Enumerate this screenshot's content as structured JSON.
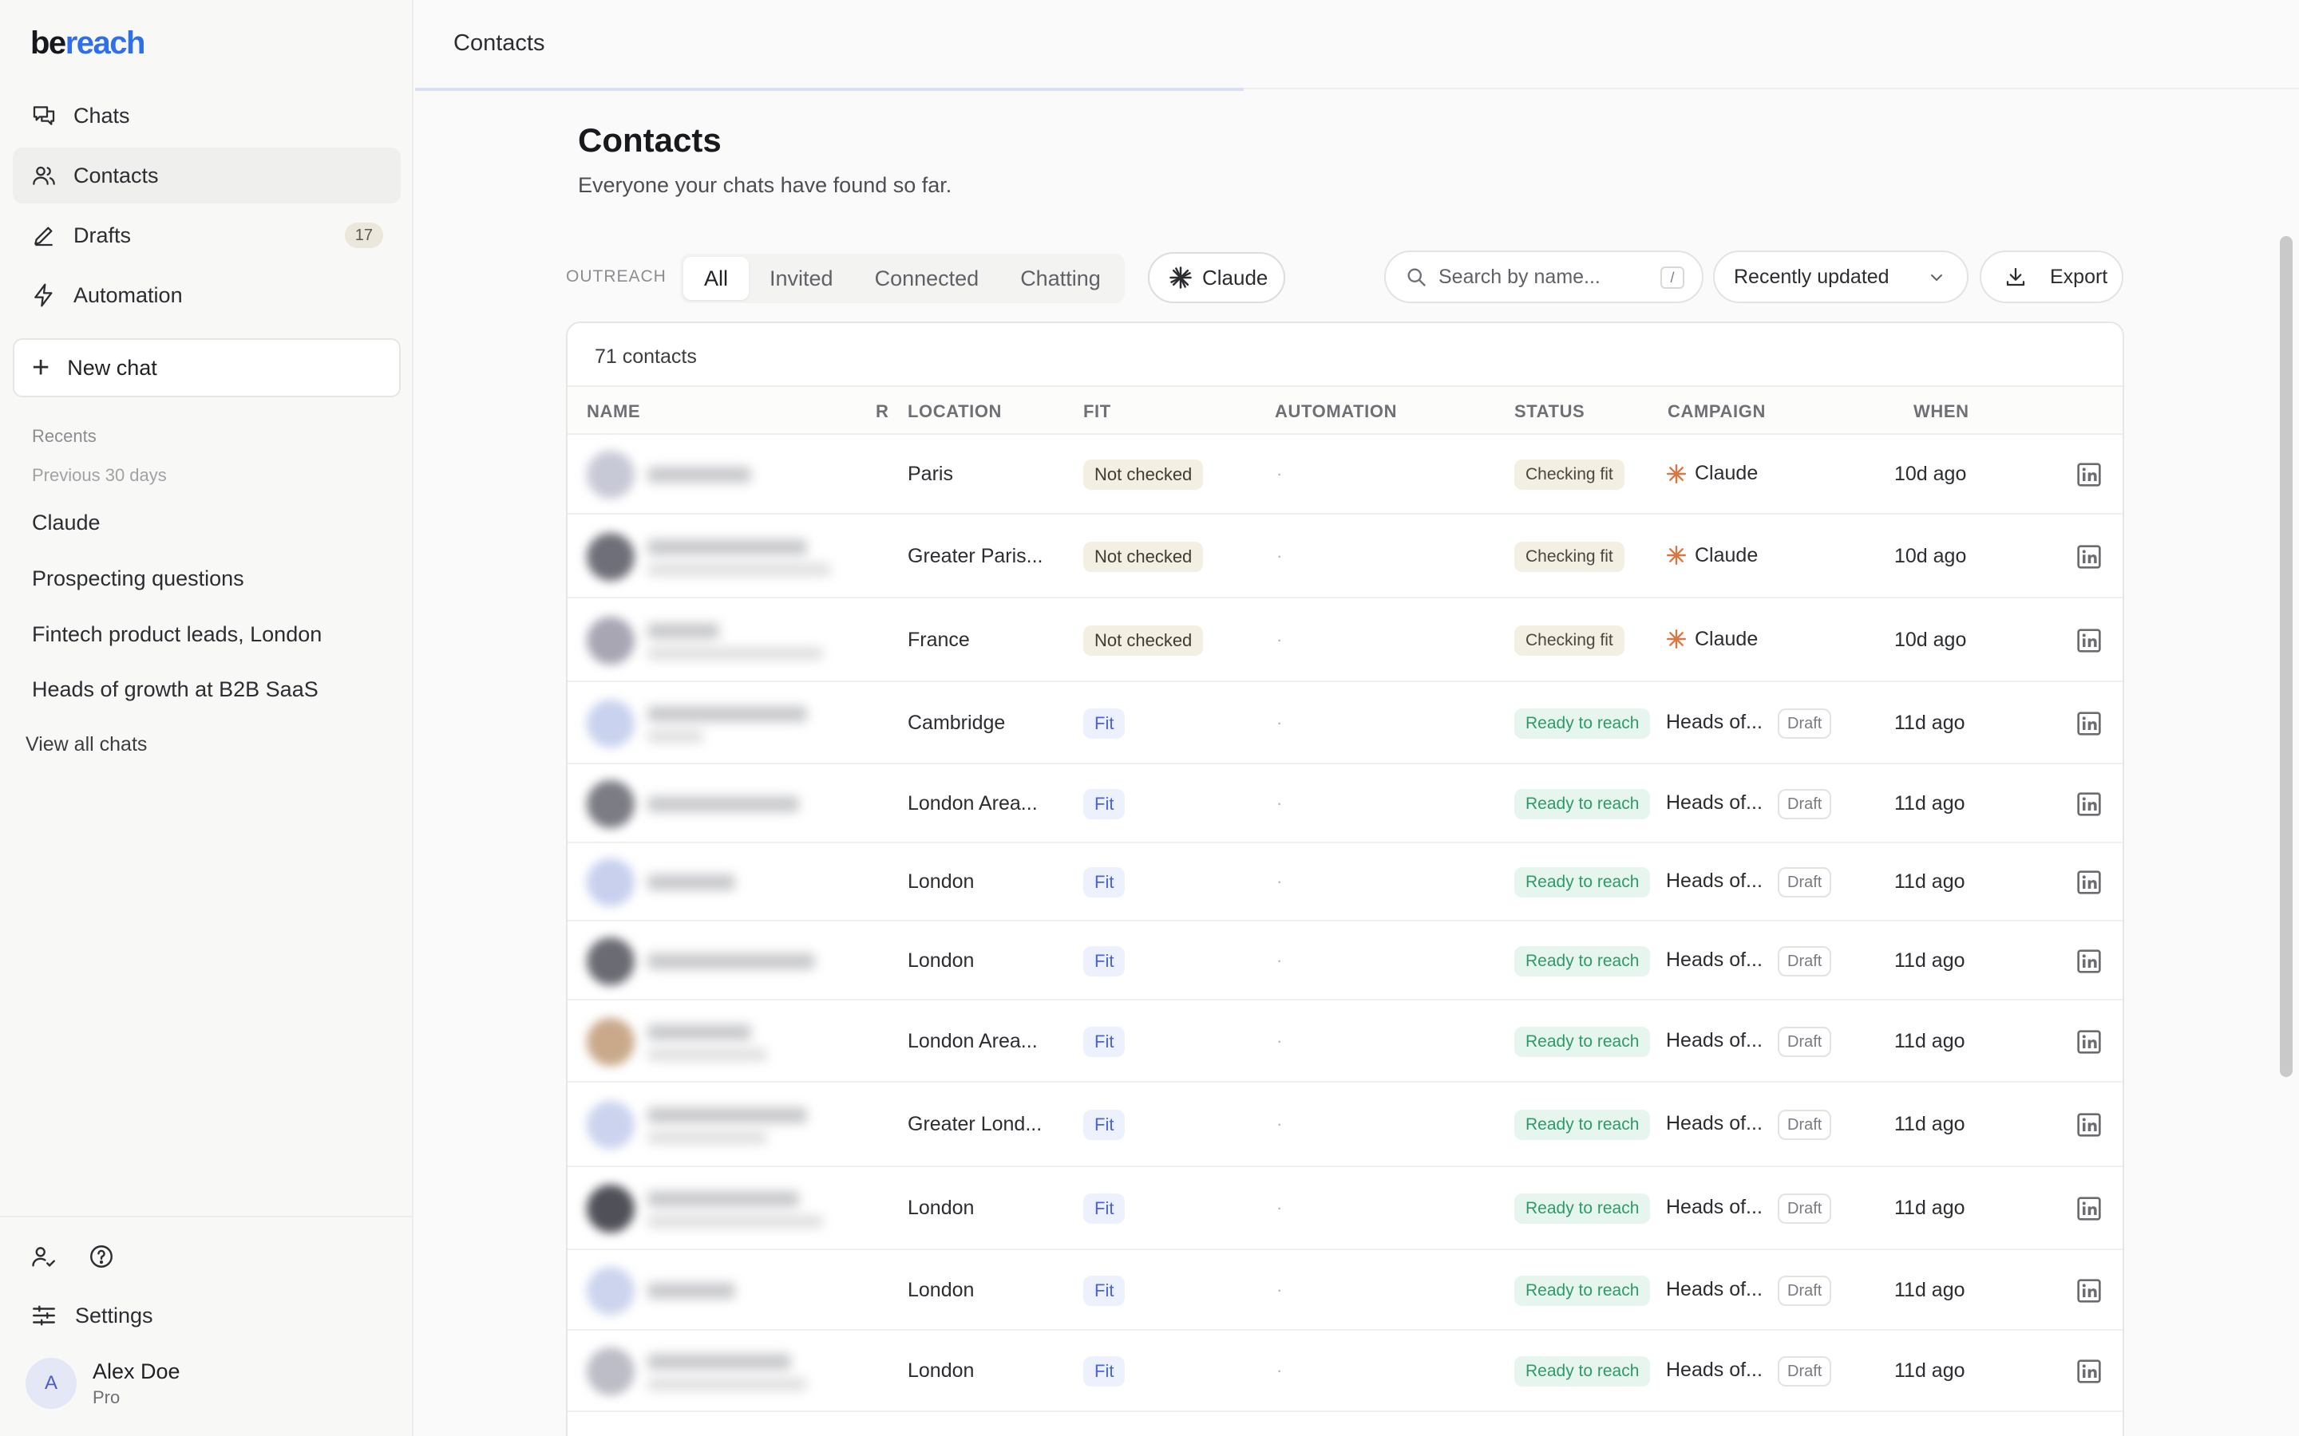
{
  "app": {
    "logo_left": "be",
    "logo_right": "reach"
  },
  "sidebar": {
    "nav": [
      {
        "label": "Chats",
        "icon": "chats-icon"
      },
      {
        "label": "Contacts",
        "icon": "contacts-icon"
      },
      {
        "label": "Drafts",
        "icon": "pencil-icon",
        "badge": "17"
      },
      {
        "label": "Automation",
        "icon": "lightning-icon"
      }
    ],
    "new_chat_label": "New chat",
    "recents_label": "Recents",
    "previous_label": "Previous 30 days",
    "recents": [
      "Claude",
      "Prospecting questions",
      "Fintech product leads, London",
      "Heads of growth at B2B SaaS"
    ],
    "view_all_label": "View all chats",
    "settings_label": "Settings",
    "user": {
      "initial": "A",
      "name": "Alex Doe",
      "plan": "Pro"
    }
  },
  "topbar": {
    "title": "Contacts",
    "loading_progress": 0.44
  },
  "page": {
    "title": "Contacts",
    "subtitle": "Everyone your chats have found so far."
  },
  "filters": {
    "outreach_label": "OUTREACH",
    "tabs": [
      "All",
      "Invited",
      "Connected",
      "Chatting"
    ],
    "active_tab": "All",
    "campaign_chip": "Claude",
    "search_placeholder": "Search by name...",
    "search_shortcut": "/",
    "sort_label": "Recently updated",
    "export_label": "Export"
  },
  "table": {
    "count_label": "71 contacts",
    "columns": [
      "NAME",
      "R",
      "LOCATION",
      "FIT",
      "AUTOMATION",
      "STATUS",
      "CAMPAIGN",
      "WHEN"
    ],
    "rows": [
      {
        "location": "Paris",
        "fit": "Not checked",
        "automation": "·",
        "status": "Checking fit",
        "campaign": "Claude",
        "draft": "",
        "when": "10d ago"
      },
      {
        "location": "Greater Paris...",
        "fit": "Not checked",
        "automation": "·",
        "status": "Checking fit",
        "campaign": "Claude",
        "draft": "",
        "when": "10d ago"
      },
      {
        "location": "France",
        "fit": "Not checked",
        "automation": "·",
        "status": "Checking fit",
        "campaign": "Claude",
        "draft": "",
        "when": "10d ago"
      },
      {
        "location": "Cambridge",
        "fit": "Fit",
        "automation": "·",
        "status": "Ready to reach",
        "campaign": "Heads of...",
        "draft": "Draft",
        "when": "11d ago"
      },
      {
        "location": "London Area...",
        "fit": "Fit",
        "automation": "·",
        "status": "Ready to reach",
        "campaign": "Heads of...",
        "draft": "Draft",
        "when": "11d ago"
      },
      {
        "location": "London",
        "fit": "Fit",
        "automation": "·",
        "status": "Ready to reach",
        "campaign": "Heads of...",
        "draft": "Draft",
        "when": "11d ago"
      },
      {
        "location": "London",
        "fit": "Fit",
        "automation": "·",
        "status": "Ready to reach",
        "campaign": "Heads of...",
        "draft": "Draft",
        "when": "11d ago"
      },
      {
        "location": "London Area...",
        "fit": "Fit",
        "automation": "·",
        "status": "Ready to reach",
        "campaign": "Heads of...",
        "draft": "Draft",
        "when": "11d ago"
      },
      {
        "location": "Greater Lond...",
        "fit": "Fit",
        "automation": "·",
        "status": "Ready to reach",
        "campaign": "Heads of...",
        "draft": "Draft",
        "when": "11d ago"
      },
      {
        "location": "London",
        "fit": "Fit",
        "automation": "·",
        "status": "Ready to reach",
        "campaign": "Heads of...",
        "draft": "Draft",
        "when": "11d ago"
      },
      {
        "location": "London",
        "fit": "Fit",
        "automation": "·",
        "status": "Ready to reach",
        "campaign": "Heads of...",
        "draft": "Draft",
        "when": "11d ago"
      },
      {
        "location": "London",
        "fit": "Fit",
        "automation": "·",
        "status": "Ready to reach",
        "campaign": "Heads of...",
        "draft": "Draft",
        "when": "11d ago"
      }
    ]
  },
  "colors": {
    "accent": "#2f6fec",
    "claude_spark": "#d97742",
    "fit_text": "#4a63d6",
    "ready_text": "#2f9a67"
  }
}
